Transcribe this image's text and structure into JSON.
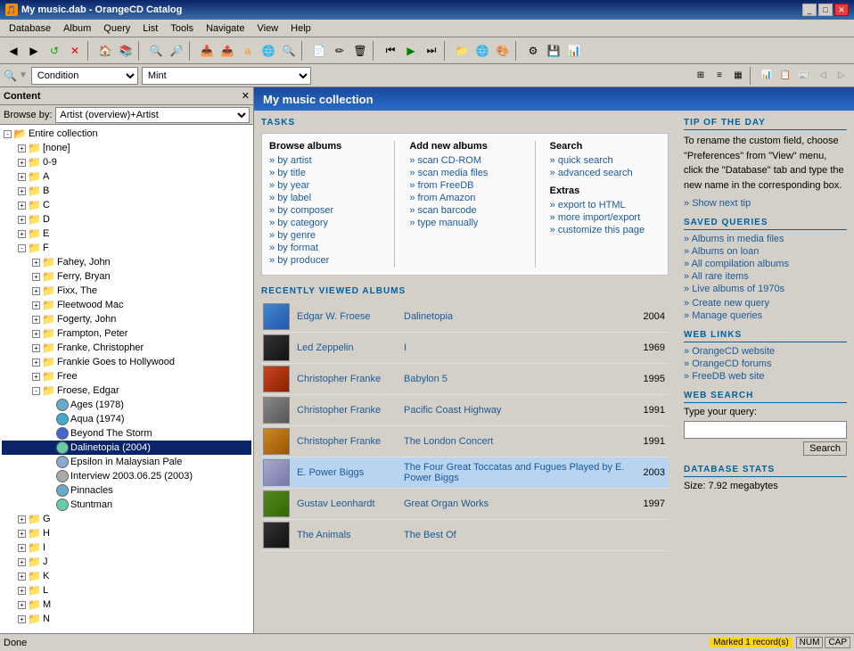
{
  "titleBar": {
    "title": "My music.dab - OrangeCD Catalog",
    "icon": "🎵"
  },
  "menuBar": {
    "items": [
      "Database",
      "Album",
      "Query",
      "List",
      "Tools",
      "Navigate",
      "View",
      "Help"
    ]
  },
  "filterBar": {
    "conditionLabel": "Condition",
    "conditionValue": "Condition",
    "mintValue": "Mint"
  },
  "content": {
    "title": "Content",
    "browseBy": "Browse by:",
    "browseOption": "Artist (overview)+Artist"
  },
  "tree": {
    "items": [
      {
        "label": "Entire collection",
        "level": 0,
        "type": "root",
        "expanded": true
      },
      {
        "label": "[none]",
        "level": 1,
        "type": "folder"
      },
      {
        "label": "0-9",
        "level": 1,
        "type": "folder"
      },
      {
        "label": "A",
        "level": 1,
        "type": "folder"
      },
      {
        "label": "B",
        "level": 1,
        "type": "folder"
      },
      {
        "label": "C",
        "level": 1,
        "type": "folder"
      },
      {
        "label": "D",
        "level": 1,
        "type": "folder"
      },
      {
        "label": "E",
        "level": 1,
        "type": "folder"
      },
      {
        "label": "F",
        "level": 1,
        "type": "folder",
        "expanded": true
      },
      {
        "label": "Fahey, John",
        "level": 2,
        "type": "artist"
      },
      {
        "label": "Ferry, Bryan",
        "level": 2,
        "type": "artist"
      },
      {
        "label": "Fixx, The",
        "level": 2,
        "type": "artist"
      },
      {
        "label": "Fleetwood Mac",
        "level": 2,
        "type": "artist"
      },
      {
        "label": "Fogerty, John",
        "level": 2,
        "type": "artist"
      },
      {
        "label": "Frampton, Peter",
        "level": 2,
        "type": "artist"
      },
      {
        "label": "Franke, Christopher",
        "level": 2,
        "type": "artist"
      },
      {
        "label": "Frankie Goes to Hollywood",
        "level": 2,
        "type": "artist"
      },
      {
        "label": "Free",
        "level": 2,
        "type": "artist"
      },
      {
        "label": "Froese, Edgar",
        "level": 2,
        "type": "artist",
        "expanded": true
      },
      {
        "label": "Ages (1978)",
        "level": 3,
        "type": "album"
      },
      {
        "label": "Aqua (1974)",
        "level": 3,
        "type": "album"
      },
      {
        "label": "Beyond The Storm",
        "level": 3,
        "type": "album"
      },
      {
        "label": "Dalinetopia (2004)",
        "level": 3,
        "type": "album",
        "selected": true
      },
      {
        "label": "Epsilon in Malaysian Pale",
        "level": 3,
        "type": "album"
      },
      {
        "label": "Interview 2003.06.25 (2003)",
        "level": 3,
        "type": "album"
      },
      {
        "label": "Pinnacles",
        "level": 3,
        "type": "album"
      },
      {
        "label": "Stuntman",
        "level": 3,
        "type": "album"
      },
      {
        "label": "G",
        "level": 1,
        "type": "folder"
      },
      {
        "label": "H",
        "level": 1,
        "type": "folder"
      },
      {
        "label": "I",
        "level": 1,
        "type": "folder"
      },
      {
        "label": "J",
        "level": 1,
        "type": "folder"
      },
      {
        "label": "K",
        "level": 1,
        "type": "folder"
      },
      {
        "label": "L",
        "level": 1,
        "type": "folder"
      },
      {
        "label": "M",
        "level": 1,
        "type": "folder"
      },
      {
        "label": "N",
        "level": 1,
        "type": "folder"
      }
    ]
  },
  "mainPanel": {
    "title": "My music collection",
    "tasks": {
      "header": "TASKS",
      "browse": {
        "title": "Browse albums",
        "links": [
          "by artist",
          "by title",
          "by year",
          "by label",
          "by composer",
          "by category",
          "by genre",
          "by format",
          "by producer"
        ]
      },
      "addNew": {
        "title": "Add new albums",
        "links": [
          "scan CD-ROM",
          "scan media files",
          "from FreeDB",
          "from Amazon",
          "scan barcode",
          "type manually"
        ]
      },
      "search": {
        "title": "Search",
        "links": [
          "quick search",
          "advanced search"
        ]
      },
      "extras": {
        "title": "Extras",
        "links": [
          "export to HTML",
          "more import/export",
          "customize this page"
        ]
      }
    },
    "recentlyViewed": {
      "header": "RECENTLY VIEWED ALBUMS",
      "albums": [
        {
          "artist": "Edgar W. Froese",
          "title": "Dalinetopia",
          "year": "2004",
          "thumbClass": "thumb-blue"
        },
        {
          "artist": "Led Zeppelin",
          "title": "I",
          "year": "1969",
          "thumbClass": "thumb-dark"
        },
        {
          "artist": "Christopher Franke",
          "title": "Babylon 5",
          "year": "1995",
          "thumbClass": "thumb-red"
        },
        {
          "artist": "Christopher Franke",
          "title": "Pacific Coast Highway",
          "year": "1991",
          "thumbClass": "thumb-gray",
          "highlighted": false
        },
        {
          "artist": "Christopher Franke",
          "title": "The London Concert",
          "year": "1991",
          "thumbClass": "thumb-orange"
        },
        {
          "artist": "E. Power Biggs",
          "title": "The Four Great Toccatas and Fugues Played by E. Power Biggs",
          "year": "2003",
          "thumbClass": "thumb-light",
          "highlighted": true
        },
        {
          "artist": "Gustav Leonhardt",
          "title": "Great Organ Works",
          "year": "1997",
          "thumbClass": "thumb-green"
        },
        {
          "artist": "The Animals",
          "title": "The Best Of",
          "year": "",
          "thumbClass": "thumb-dark"
        }
      ]
    }
  },
  "sidebar": {
    "tipOfDay": {
      "header": "TIP OF THE DAY",
      "text": "To rename the custom field, choose \"Preferences\" from \"View\" menu, click the \"Database\" tab and type the new name in the corresponding box.",
      "showNextTip": "Show next tip"
    },
    "savedQueries": {
      "header": "SAVED QUERIES",
      "items": [
        "Albums in media files",
        "Albums on loan",
        "All compilation albums",
        "All rare items",
        "Live albums of 1970s"
      ],
      "extraLinks": [
        "Create new query",
        "Manage queries"
      ]
    },
    "webLinks": {
      "header": "WEB LINKS",
      "items": [
        "OrangeCD website",
        "OrangeCD forums",
        "FreeDB web site"
      ]
    },
    "webSearch": {
      "header": "WEB SEARCH",
      "label": "Type your query:",
      "placeholder": "",
      "searchButton": "Search"
    },
    "dbStats": {
      "header": "DATABASE STATS",
      "sizeLabel": "Size: 7.92 megabytes"
    }
  },
  "statusBar": {
    "left": "Done",
    "badge": "Marked 1 record(s)",
    "keys": [
      "NUM",
      "CAP"
    ]
  }
}
